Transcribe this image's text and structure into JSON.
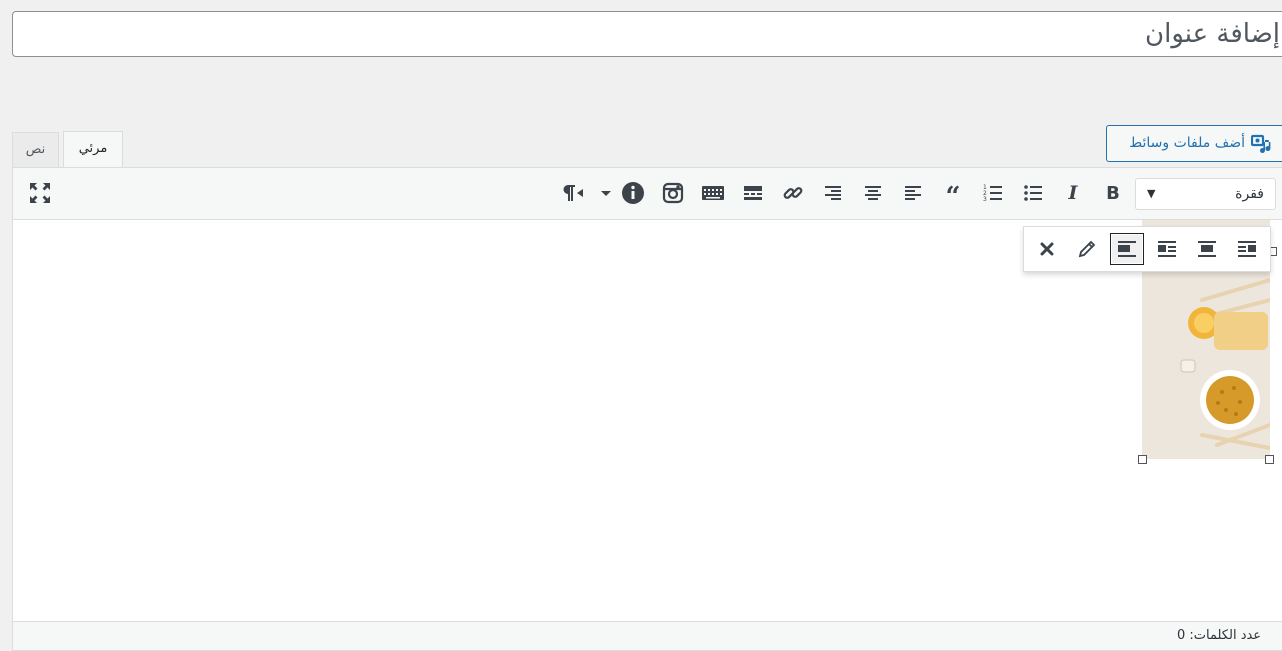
{
  "post_title": {
    "placeholder": "إضافة عنوان"
  },
  "media_button": {
    "label": "أضف ملفات وسائط",
    "icon": "add-media-icon"
  },
  "editor_tabs": {
    "visual": "مرئي",
    "text": "نص"
  },
  "toolbar": {
    "format_select": "فقرة",
    "buttons": [
      "bold",
      "italic",
      "bulleted-list",
      "numbered-list",
      "blockquote",
      "align-left",
      "align-center",
      "align-right",
      "insert-link",
      "read-more",
      "toolbar-toggle",
      "instagram",
      "info",
      "paragraph-rtl",
      "fullscreen"
    ]
  },
  "image_toolbar": {
    "buttons": [
      "align-right",
      "align-center",
      "align-left",
      "no-align",
      "edit",
      "remove"
    ],
    "active": "no-align"
  },
  "statusbar": {
    "word_count": "عدد الكلمات: 0"
  },
  "colors": {
    "accent": "#2271b1",
    "background": "#f0f0f1",
    "toolbar": "#f6f7f7"
  }
}
